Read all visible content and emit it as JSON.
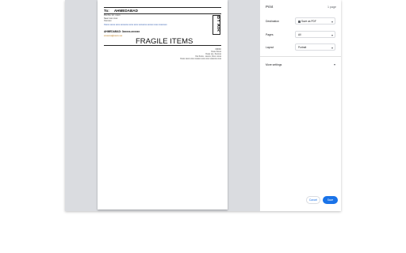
{
  "preview": {
    "to_prefix": "To:",
    "destination": "AHMEDABAD",
    "address_lines": [
      "Plot No. 12, xxxxx",
      "Near xxxx xxxx",
      "Xxxxxxx",
      "Xxxxx xxxxx xxxx xxxxxxxx xxxx xxxx xxxxxxxx xxxxxx xxxx xxxxxxxx"
    ],
    "city_line": "AHMEDABAD: 3xxxxx-xxxxxx",
    "email_line": "xxxxxxxx@xxxxx.xxx",
    "side_label": "BY AIR",
    "fragile_label": "FRAGILE ITEMS",
    "from_lines": [
      "FROM:",
      "Xxxxx Xxxxx",
      "Xxxxx xxx, Xxxxxxx",
      "Xxx Xxxxx - xxxxxx, Xxxx: xxxxx",
      "Xxxxx xxxxx xxxx xxxxxxx xxxx xxxx xxxxxxxx xxxx"
    ]
  },
  "settings": {
    "title": "Print",
    "sheet_count": "1 page",
    "rows": [
      {
        "label": "Destination",
        "value": "Save as PDF"
      },
      {
        "label": "Pages",
        "value": "All"
      },
      {
        "label": "Layout",
        "value": "Portrait"
      }
    ],
    "more_settings": "More settings",
    "cancel_label": "Cancel",
    "save_label": "Save"
  },
  "colors": {
    "accent": "#1a73e8",
    "preview_bg": "#dadce0"
  },
  "icons": {
    "printer": "printer-icon",
    "chevron": "chevron-down-icon"
  }
}
